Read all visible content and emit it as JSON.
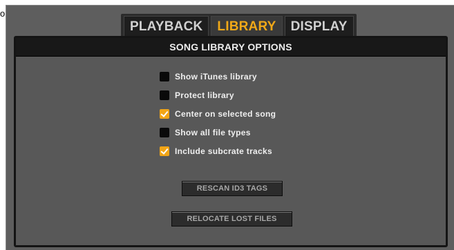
{
  "edge": {
    "text": "or"
  },
  "tabs": [
    {
      "label": "PLAYBACK",
      "active": false
    },
    {
      "label": "LIBRARY",
      "active": true
    },
    {
      "label": "DISPLAY",
      "active": false
    }
  ],
  "section": {
    "title": "SONG LIBRARY OPTIONS",
    "options": [
      {
        "label": "Show iTunes library",
        "checked": false
      },
      {
        "label": "Protect library",
        "checked": false
      },
      {
        "label": "Center on selected song",
        "checked": true
      },
      {
        "label": "Show all file types",
        "checked": false
      },
      {
        "label": "Include subcrate tracks",
        "checked": true
      }
    ],
    "buttons": {
      "rescan": "RESCAN ID3 TAGS",
      "relocate": "RELOCATE LOST FILES"
    }
  },
  "colors": {
    "accent": "#f0a818",
    "panel_bg": "#5e5e5e",
    "header_bg": "#181818"
  }
}
